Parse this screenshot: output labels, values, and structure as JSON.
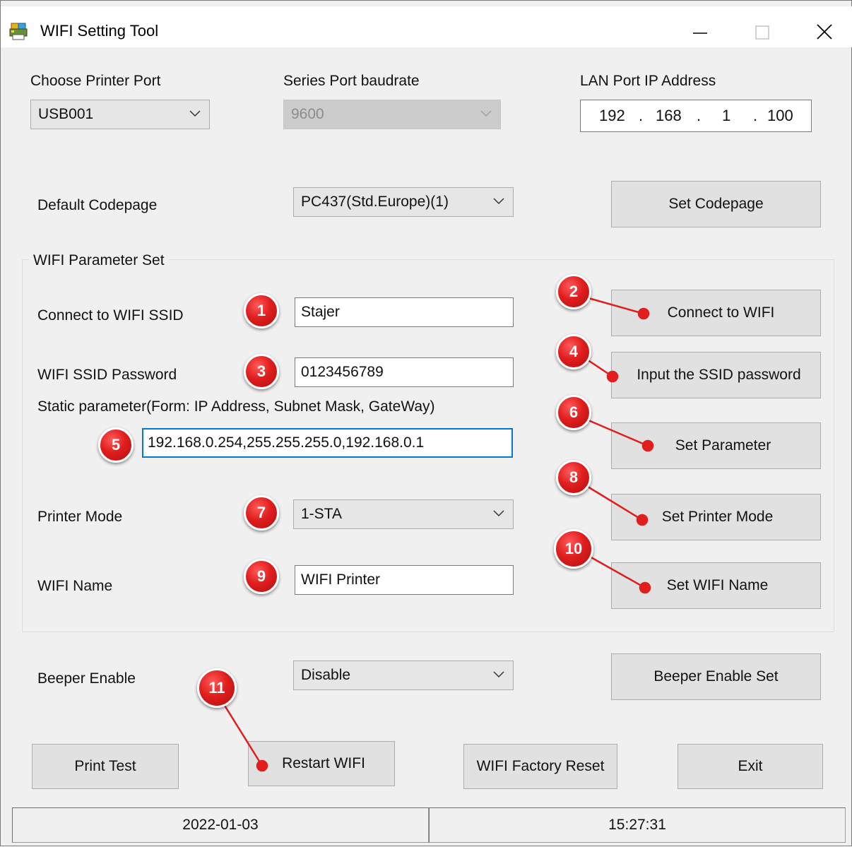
{
  "window": {
    "title": "WIFI Setting Tool",
    "controls": {
      "minimize": "—",
      "maximize": "☐",
      "close": "✕"
    }
  },
  "ports": {
    "printer_port_label": "Choose Printer Port",
    "printer_port_value": "USB001",
    "baudrate_label": "Series Port baudrate",
    "baudrate_value": "9600",
    "lan_label": "LAN Port IP Address",
    "lan_ip": [
      "192",
      "168",
      "1",
      "100"
    ]
  },
  "codepage": {
    "label": "Default Codepage",
    "value": "PC437(Std.Europe)(1)",
    "button": "Set Codepage"
  },
  "wifi_group": {
    "title": "WIFI Parameter Set",
    "ssid_label": "Connect to WIFI SSID",
    "ssid_value": "Stajer",
    "connect_button": "Connect to WIFI",
    "password_label": "WIFI SSID Password",
    "password_value": "0123456789",
    "password_button": "Input the SSID password",
    "static_label": "Static parameter(Form: IP Address, Subnet Mask, GateWay)",
    "static_value": "192.168.0.254,255.255.255.0,192.168.0.1",
    "set_param_button": "Set Parameter",
    "mode_label": "Printer Mode",
    "mode_value": "1-STA",
    "mode_button": "Set Printer Mode",
    "name_label": "WIFI Name",
    "name_value": "WIFI Printer",
    "name_button": "Set WIFI Name"
  },
  "beeper": {
    "label": "Beeper Enable",
    "value": "Disable",
    "button": "Beeper Enable Set"
  },
  "bottom_buttons": {
    "print_test": "Print Test",
    "restart": "Restart WIFI",
    "factory_reset": "WIFI Factory Reset",
    "exit": "Exit"
  },
  "status": {
    "date": "2022-01-03",
    "time": "15:27:31"
  },
  "badges": [
    "1",
    "2",
    "3",
    "4",
    "5",
    "6",
    "7",
    "8",
    "9",
    "10",
    "11"
  ],
  "colors": {
    "badge_red": "#e01e1e",
    "focus_blue": "#0078d7",
    "window_bg": "#f0f0f0",
    "button_bg": "#e1e1e1"
  }
}
